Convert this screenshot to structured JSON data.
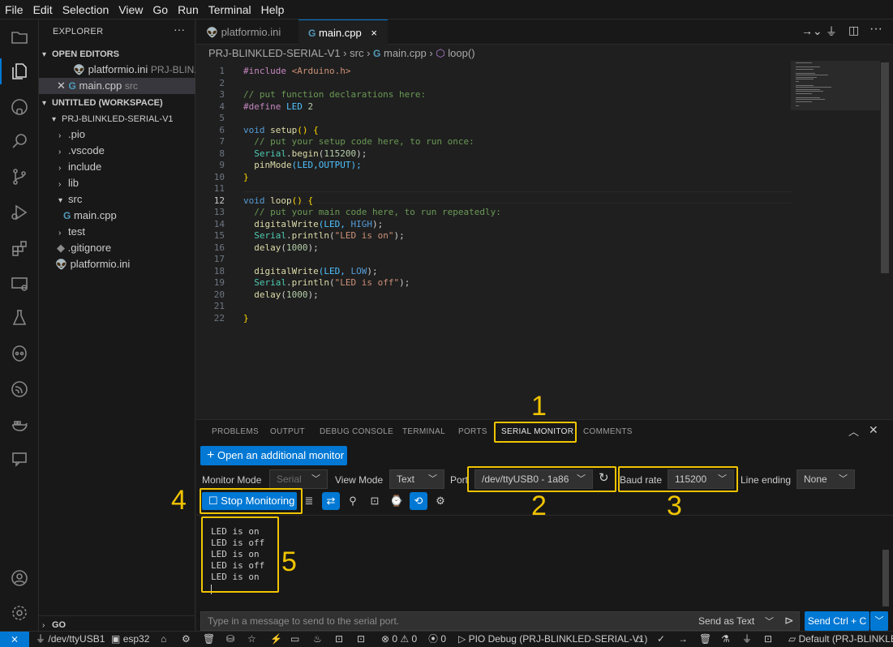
{
  "menu": [
    "File",
    "Edit",
    "Selection",
    "View",
    "Go",
    "Run",
    "Terminal",
    "Help"
  ],
  "explorer": {
    "title": "EXPLORER",
    "more": "···",
    "open_editors_label": "OPEN EDITORS",
    "open_editors": [
      {
        "name": "platformio.ini",
        "hint": "PRJ-BLIN..."
      },
      {
        "name": "main.cpp",
        "hint": "src"
      }
    ],
    "workspace_label": "UNTITLED (WORKSPACE)",
    "project": "PRJ-BLINKLED-SERIAL-V1",
    "tree": [
      ".pio",
      ".vscode",
      "include",
      "lib",
      "src",
      "main.cpp",
      "test",
      ".gitignore",
      "platformio.ini"
    ],
    "go_label": "GO"
  },
  "tabs": [
    {
      "label": "platformio.ini"
    },
    {
      "label": "main.cpp",
      "close": "×"
    }
  ],
  "breadcrumb": [
    "PRJ-BLINKLED-SERIAL-V1",
    "src",
    "main.cpp",
    "loop()"
  ],
  "editor": {
    "line_numbers": [
      "1",
      "2",
      "3",
      "4",
      "5",
      "6",
      "7",
      "8",
      "9",
      "10",
      "11",
      "12",
      "13",
      "14",
      "15",
      "16",
      "17",
      "18",
      "19",
      "20",
      "21",
      "22"
    ],
    "l1": {
      "a": "#include",
      "b": " <Arduino.h>"
    },
    "l3": "// put function declarations here:",
    "l4": {
      "a": "#define",
      "b": " LED ",
      "c": "2"
    },
    "l6": {
      "a": "void",
      "b": " setup",
      "c": "() {"
    },
    "l7": "  // put your setup code here, to run once:",
    "l8": {
      "a": "  Serial",
      "b": ".",
      "c": "begin",
      "d": "(",
      "e": "115200",
      "f": ");"
    },
    "l9": {
      "a": "  pinMode",
      "b": "(LED,OUTPUT);"
    },
    "l10": "}",
    "l12": {
      "a": "void",
      "b": " loop",
      "c": "() {"
    },
    "l13": "  // put your main code here, to run repeatedly:",
    "l14": {
      "a": "  digitalWrite",
      "b": "(LED, ",
      "c": "HIGH",
      "d": ");"
    },
    "l15": {
      "a": "  Serial",
      "b": ".",
      "c": "println",
      "d": "(",
      "e": "\"LED is on\"",
      "f": ");"
    },
    "l16": {
      "a": "  delay",
      "b": "(",
      "c": "1000",
      "d": ");"
    },
    "l18": {
      "a": "  digitalWrite",
      "b": "(LED, ",
      "c": "LOW",
      "d": ");"
    },
    "l19": {
      "a": "  Serial",
      "b": ".",
      "c": "println",
      "d": "(",
      "e": "\"LED is off\"",
      "f": ");"
    },
    "l20": {
      "a": "  delay",
      "b": "(",
      "c": "1000",
      "d": ");"
    },
    "l22": "}"
  },
  "panel": {
    "tabs": [
      "PROBLEMS",
      "OUTPUT",
      "DEBUG CONSOLE",
      "TERMINAL",
      "PORTS",
      "SERIAL MONITOR",
      "COMMENTS"
    ],
    "open_monitor": "Open an additional monitor",
    "monitor_mode_label": "Monitor Mode",
    "monitor_mode": "Serial",
    "view_mode_label": "View Mode",
    "view_mode": "Text",
    "port_label": "Port",
    "port": "/dev/ttyUSB0 - 1a86",
    "baud_label": "Baud rate",
    "baud": "115200",
    "line_ending_label": "Line ending",
    "line_ending": "None",
    "stop_monitoring": "Stop Monitoring",
    "output": [
      "LED is on",
      "LED is off",
      "LED is on",
      "LED is off",
      "LED is on"
    ],
    "input_placeholder": "Type in a message to send to the serial port.",
    "send_as": "Send as Text",
    "send_ctrl_c": "Send Ctrl + C"
  },
  "annotations": [
    "1",
    "2",
    "3",
    "4",
    "5"
  ],
  "annotation_color": "#f0c400",
  "status": {
    "remote": "⨯",
    "port": "/dev/ttyUSB1",
    "board": "esp32",
    "problems": "⊗ 0 ⚠ 0",
    "ports": "0",
    "debug": "PIO Debug (PRJ-BLINKLED-SERIAL-V1)",
    "env": "Default (PRJ-BLINKLED"
  },
  "accent": "#0078d4"
}
